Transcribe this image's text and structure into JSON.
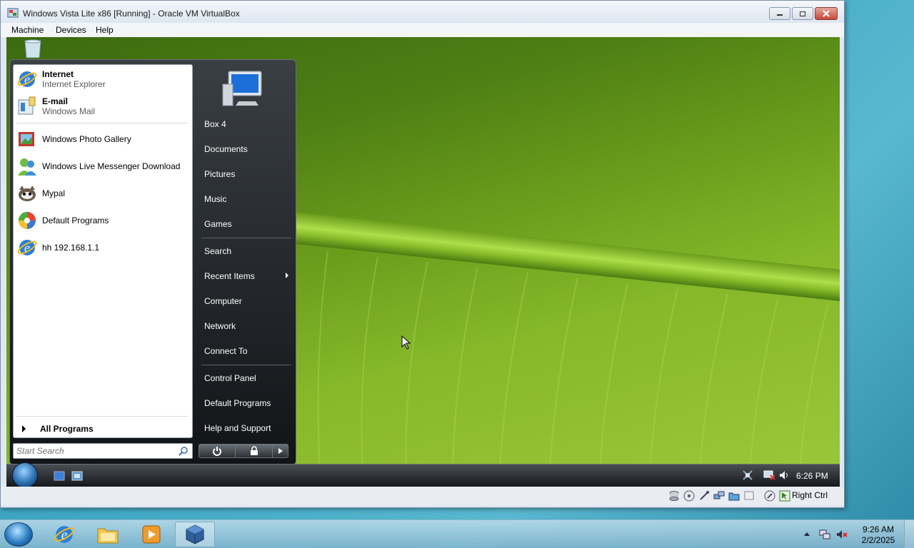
{
  "vbox": {
    "title": "Windows Vista Lite x86 [Running] - Oracle VM VirtualBox",
    "menu": [
      "Machine",
      "Devices",
      "Help"
    ],
    "status_right_ctrl": "Right Ctrl"
  },
  "start_menu": {
    "pinned": [
      {
        "title": "Internet",
        "subtitle": "Internet Explorer",
        "icon": "internet-explorer-icon"
      },
      {
        "title": "E-mail",
        "subtitle": "Windows Mail",
        "icon": "windows-mail-icon"
      }
    ],
    "recent": [
      {
        "label": "Windows Photo Gallery",
        "icon": "photo-gallery-icon"
      },
      {
        "label": "Windows Live Messenger Download",
        "icon": "messenger-icon"
      },
      {
        "label": "Mypal",
        "icon": "mypal-icon"
      },
      {
        "label": "Default Programs",
        "icon": "default-programs-icon"
      },
      {
        "label": "hh 192.168.1.1",
        "icon": "internet-explorer-icon"
      }
    ],
    "all_programs": "All Programs",
    "search_placeholder": "Start Search",
    "right_items": [
      "Box 4",
      "Documents",
      "Pictures",
      "Music",
      "Games",
      "Search",
      "Recent Items",
      "Computer",
      "Network",
      "Connect To",
      "Control Panel",
      "Default Programs",
      "Help and Support"
    ]
  },
  "guest_taskbar": {
    "time": "6:26 PM"
  },
  "host_taskbar": {
    "time": "9:26 AM",
    "date": "2/2/2025"
  }
}
